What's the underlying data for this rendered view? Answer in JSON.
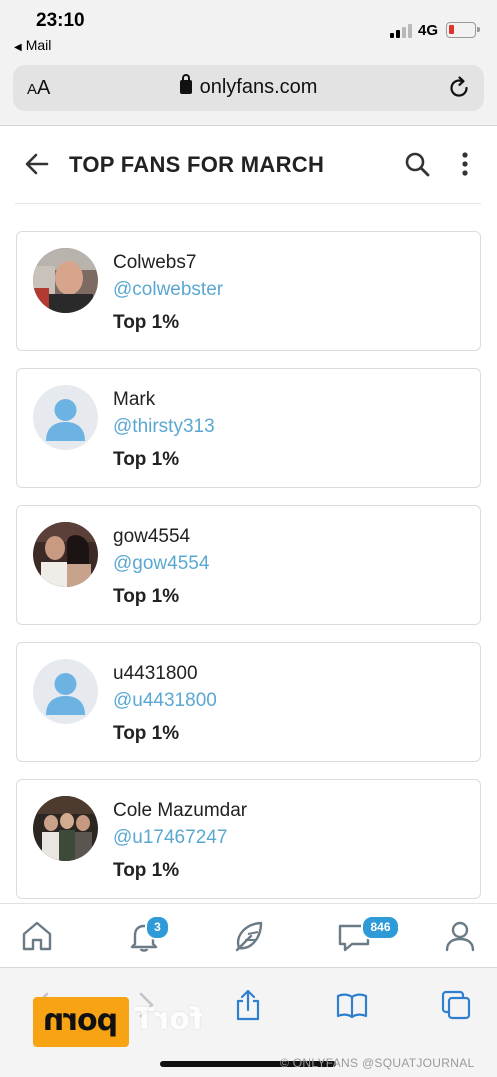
{
  "status_bar": {
    "time": "23:10",
    "back_app": "Mail",
    "network": "4G"
  },
  "browser": {
    "text_size_label_small": "A",
    "text_size_label_large": "A",
    "url": "onlyfans.com"
  },
  "header": {
    "title": "TOP FANS FOR MARCH"
  },
  "fans": [
    {
      "name": "Colwebs7",
      "handle": "@colwebster",
      "rank": "Top 1%",
      "avatar": "photo"
    },
    {
      "name": "Mark",
      "handle": "@thirsty313",
      "rank": "Top 1%",
      "avatar": "default"
    },
    {
      "name": "gow4554",
      "handle": "@gow4554",
      "rank": "Top 1%",
      "avatar": "photo"
    },
    {
      "name": "u4431800",
      "handle": "@u4431800",
      "rank": "Top 1%",
      "avatar": "default"
    },
    {
      "name": "Cole Mazumdar",
      "handle": "@u17467247",
      "rank": "Top 1%",
      "avatar": "photo"
    }
  ],
  "bottom_nav": {
    "items": [
      "home-icon",
      "bell-icon",
      "feather-icon",
      "messages-icon",
      "profile-icon"
    ],
    "notifications_count": "3",
    "messages_count": "846",
    "accent_color": "#2f9ad8"
  },
  "overlays": {
    "logo_text": "porn",
    "logo_ghost_text": "forT",
    "watermark": "© ONLYFANS @SQUATJOURNAL"
  }
}
